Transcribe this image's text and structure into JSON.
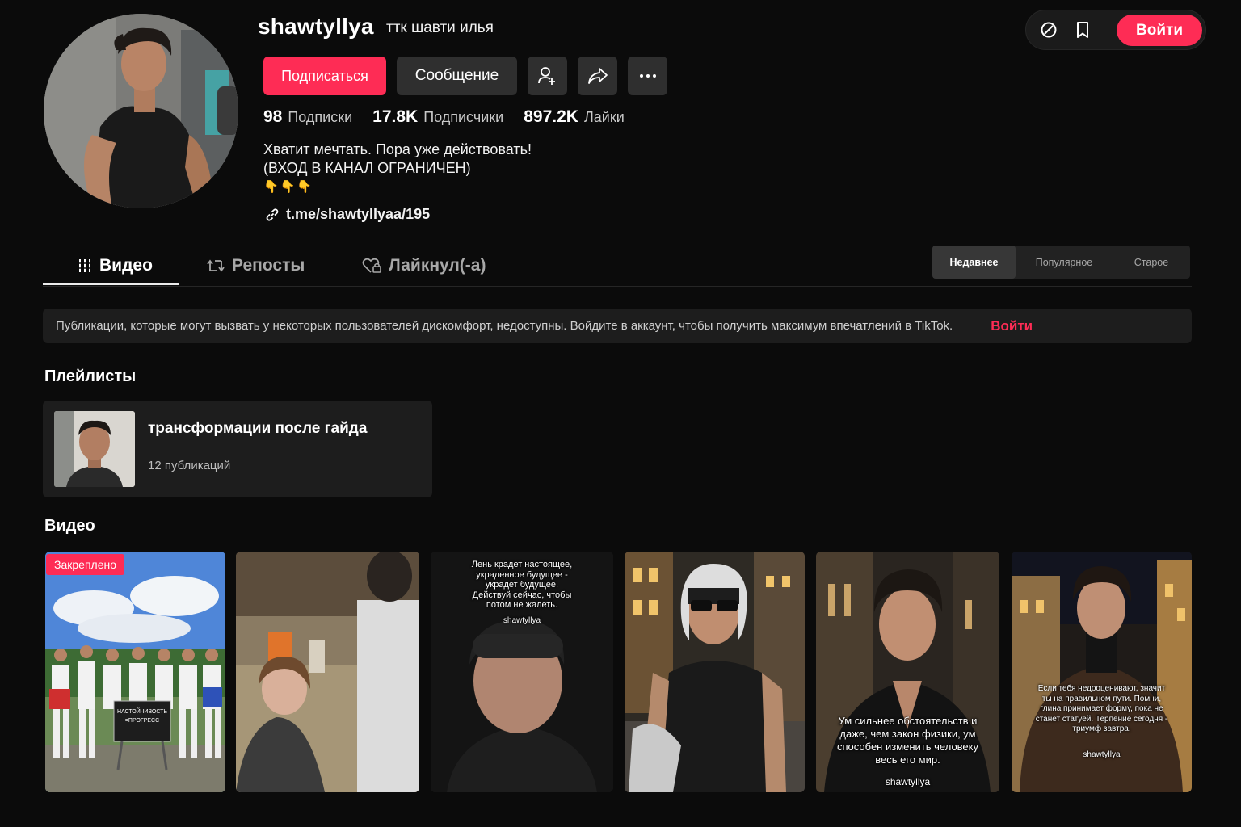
{
  "header": {
    "login_label": "Войти"
  },
  "profile": {
    "username": "shawtyllya",
    "nickname": "ттк шавти илья",
    "follow_label": "Подписаться",
    "message_label": "Сообщение",
    "stats": [
      {
        "num": "98",
        "label": "Подписки"
      },
      {
        "num": "17.8K",
        "label": "Подписчики"
      },
      {
        "num": "897.2K",
        "label": "Лайки"
      }
    ],
    "bio_line1": "Хватит мечтать. Пора уже действовать!",
    "bio_line2": "(ВХОД В КАНАЛ ОГРАНИЧЕН)",
    "bio_emoji": "👇👇👇",
    "link": "t.me/shawtyllyaa/195"
  },
  "tabs": [
    {
      "label": "Видео",
      "icon": "grid-bars-icon"
    },
    {
      "label": "Репосты",
      "icon": "repost-icon"
    },
    {
      "label": "Лайкнул(-а)",
      "icon": "heart-lock-icon"
    }
  ],
  "sort": {
    "options": [
      "Недавнее",
      "Популярное",
      "Старое"
    ],
    "selected": "Недавнее"
  },
  "notice": {
    "text": "Публикации, которые могут вызвать у некоторых пользователей дискомфорт, недоступны. Войдите в аккаунт, чтобы получить максимум впечатлений в TikTok.",
    "login": "Войти"
  },
  "playlists": {
    "title": "Плейлисты",
    "items": [
      {
        "title": "трансформации после гайда",
        "count": "12 публикаций"
      }
    ]
  },
  "videos": {
    "title": "Видео",
    "pinned_label": "Закреплено",
    "items": [
      {
        "overlay": "",
        "tag": "",
        "sign": "НАСТОЙЧИВОСТЬ\n=ПРОГРЕСС"
      },
      {
        "overlay": "",
        "tag": "",
        "sign": ""
      },
      {
        "overlay": "Лень крадет настоящее, украденное будущее - украдет будущее. Действуй сейчас, чтобы потом не жалеть.",
        "tag": "shawtyllya",
        "sign": ""
      },
      {
        "overlay": "",
        "tag": "",
        "sign": ""
      },
      {
        "overlay": "Ум сильнее обстоятельств и даже, чем закон физики, ум способен изменить человеку весь его мир.",
        "tag": "shawtyllya",
        "sign": ""
      },
      {
        "overlay": "Если тебя недооценивают, значит ты на правильном пути. Помни, глина принимает форму, пока не станет статуей. Терпение сегодня - триумф завтра.",
        "tag": "shawtyllya",
        "sign": ""
      }
    ]
  },
  "colors": {
    "accent": "#fe2c55",
    "background": "#0b0b0b",
    "surface": "#1d1d1d"
  }
}
